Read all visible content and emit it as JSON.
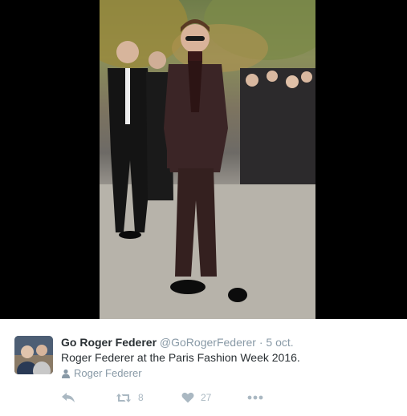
{
  "tweet": {
    "display_name": "Go Roger Federer",
    "handle": "@GoRogerFederer",
    "separator": "·",
    "timestamp": "5 oct.",
    "text": "Roger Federer at the Paris Fashion Week 2016.",
    "place": "Roger Federer"
  },
  "actions": {
    "reply_icon": "reply-icon",
    "retweet_count": "8",
    "like_count": "27",
    "more_icon": "more-icon"
  },
  "colors": {
    "name": "#292f33",
    "meta": "#8899a6",
    "action": "#aab8c2",
    "media_background": "#000000"
  }
}
